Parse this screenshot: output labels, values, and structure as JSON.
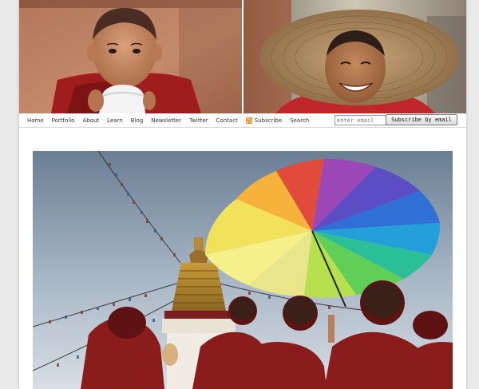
{
  "nav": {
    "items": [
      "Home",
      "Portfolio",
      "About",
      "Learn",
      "Blog",
      "Newsletter",
      "Twitter",
      "Contact",
      "Subscribe",
      "Search"
    ]
  },
  "subscribe_form": {
    "email_placeholder": "enter email",
    "button_label": "Subscribe by email"
  },
  "colors": {
    "page_bg": "#e9e9e9",
    "content_bg": "#ffffff",
    "rss_orange": "#f59521",
    "robe_red": "#9e1f1f"
  },
  "icons": {
    "subscribe": "rss-icon"
  }
}
